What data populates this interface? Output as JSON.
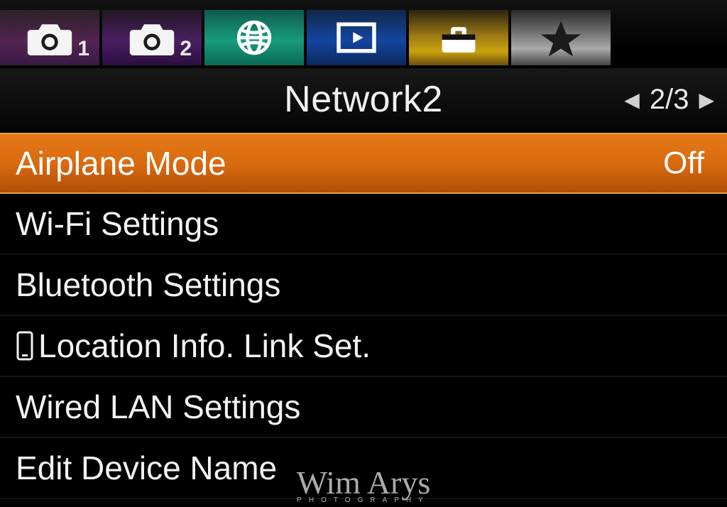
{
  "tabs": [
    {
      "name": "camera1",
      "icon": "camera",
      "sub": "1"
    },
    {
      "name": "camera2",
      "icon": "camera",
      "sub": "2"
    },
    {
      "name": "network",
      "icon": "globe",
      "selected": true
    },
    {
      "name": "playback",
      "icon": "play"
    },
    {
      "name": "toolbox",
      "icon": "toolbox"
    },
    {
      "name": "favorites",
      "icon": "star"
    }
  ],
  "title": "Network2",
  "pager": {
    "current": "2",
    "total": "3",
    "display": "2/3"
  },
  "menu": [
    {
      "label": "Airplane Mode",
      "value": "Off",
      "selected": true
    },
    {
      "label": "Wi-Fi Settings"
    },
    {
      "label": "Bluetooth Settings"
    },
    {
      "label": "Location Info. Link Set.",
      "icon": "phone"
    },
    {
      "label": "Wired LAN Settings"
    },
    {
      "label": "Edit Device Name"
    }
  ],
  "watermark": {
    "name": "Wim Arys",
    "sub": "PHOTOGRAPHY"
  }
}
